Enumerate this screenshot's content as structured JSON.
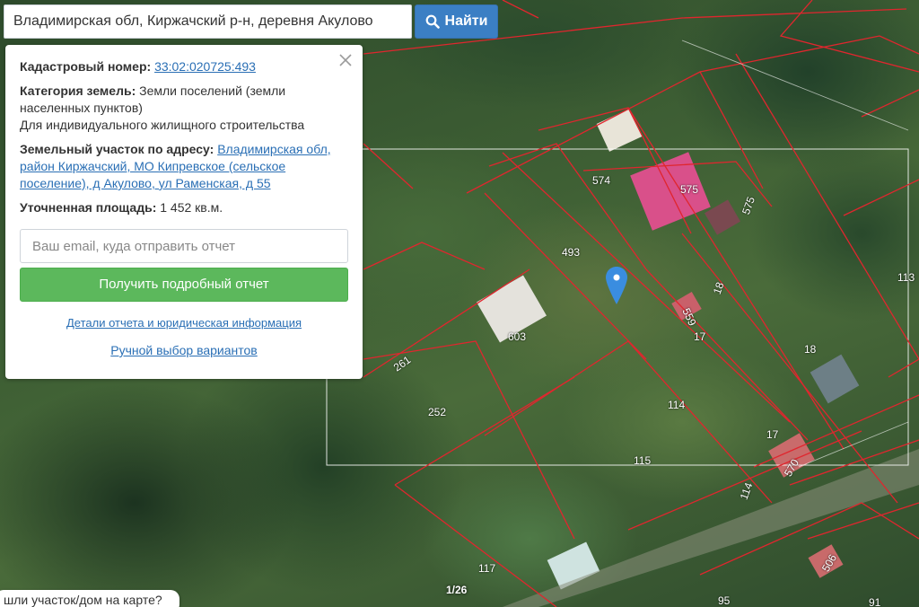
{
  "search": {
    "value": "Владимирская обл, Киржачский р-н, деревня Акулово",
    "button_label": "Найти",
    "button_icon": "search-icon"
  },
  "panel": {
    "cadastral_label": "Кадастровый номер:",
    "cadastral_number": "33:02:020725:493",
    "category_label": "Категория земель:",
    "category_value": "Земли поселений (земли населенных пунктов)",
    "permitted_use": "Для индивидуального жилищного строительства",
    "address_label": "Земельный участок по адресу:",
    "address_value": "Владимирская обл, район Киржачский, МО Кипревское (сельское поселение), д Акулово, ул Раменская, д 55",
    "area_label": "Уточненная площадь:",
    "area_value": "1 452 кв.м.",
    "email_placeholder": "Ваш email, куда отправить отчет",
    "report_button": "Получить подробный отчет",
    "details_link": "Детали отчета и юридическая информация",
    "manual_link": "Ручной выбор вариантов"
  },
  "map": {
    "parcel_numbers": [
      "574",
      "575",
      "575",
      "493",
      "113",
      "18",
      "559",
      "17",
      "18",
      "603",
      "261",
      "252",
      "114",
      "17",
      "570",
      "115",
      "114",
      "117",
      "506",
      "91",
      "95"
    ],
    "marker_icon": "map-pin-icon",
    "parcel_line_color": "#e0262e",
    "selection_color": "#ffffff"
  },
  "pager": {
    "label": "1/26"
  },
  "tooltip": {
    "text": "шли участок/дом на карте?"
  }
}
